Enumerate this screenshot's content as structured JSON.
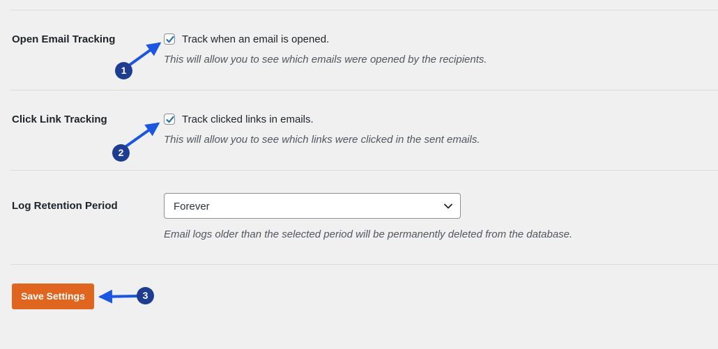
{
  "open_email_tracking": {
    "label": "Open Email Tracking",
    "checkbox_label": "Track when an email is opened.",
    "checked": true,
    "description": "This will allow you to see which emails were opened by the recipients."
  },
  "click_link_tracking": {
    "label": "Click Link Tracking",
    "checkbox_label": "Track clicked links in emails.",
    "checked": true,
    "description": "This will allow you to see which links were clicked in the sent emails."
  },
  "log_retention": {
    "label": "Log Retention Period",
    "selected": "Forever",
    "description": "Email logs older than the selected period will be permanently deleted from the database."
  },
  "save_button": {
    "label": "Save Settings"
  },
  "annotations": [
    {
      "number": "1"
    },
    {
      "number": "2"
    },
    {
      "number": "3"
    }
  ],
  "colors": {
    "accent": "#e0651f",
    "checkmark": "#2271b1",
    "badge": "#1e3d91",
    "arrow": "#1a56e0",
    "background": "#f0f0f1"
  }
}
